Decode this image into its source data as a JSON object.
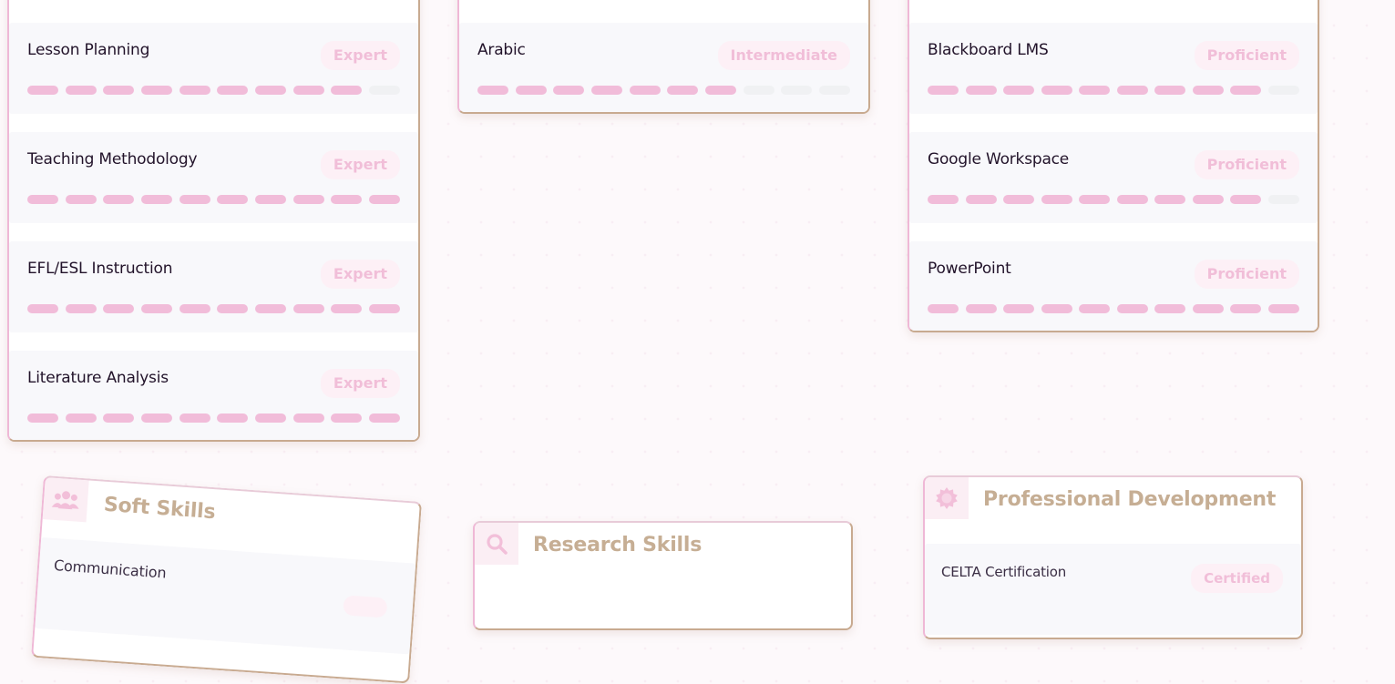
{
  "colors": {
    "accent_pink": "#f1bcd9",
    "heading_tan": "#c6ae94",
    "text_dark": "#22132a",
    "badge_bg": "#fdf0f6"
  },
  "teaching": {
    "skills": [
      {
        "name": "Lesson Planning",
        "level": "Expert",
        "filled": 9,
        "total": 10
      },
      {
        "name": "Teaching Methodology",
        "level": "Expert",
        "filled": 10,
        "total": 10
      },
      {
        "name": "EFL/ESL Instruction",
        "level": "Expert",
        "filled": 10,
        "total": 10
      },
      {
        "name": "Literature Analysis",
        "level": "Expert",
        "filled": 10,
        "total": 10
      }
    ]
  },
  "languages": {
    "skills": [
      {
        "name": "Arabic",
        "level": "Intermediate",
        "filled": 7,
        "total": 10
      }
    ]
  },
  "technology": {
    "skills": [
      {
        "name": "Blackboard LMS",
        "level": "Proficient",
        "filled": 9,
        "total": 10
      },
      {
        "name": "Google Workspace",
        "level": "Proficient",
        "filled": 9,
        "total": 10
      },
      {
        "name": "PowerPoint",
        "level": "Proficient",
        "filled": 10,
        "total": 10
      }
    ]
  },
  "soft_skills": {
    "title": "Soft Skills",
    "icon": "users-icon",
    "skills": [
      {
        "name": "Communication"
      }
    ]
  },
  "research_skills": {
    "title": "Research Skills",
    "icon": "search-icon"
  },
  "professional_development": {
    "title": "Professional Development",
    "icon": "badge-icon",
    "skills": [
      {
        "name": "CELTA Certification",
        "level": "Certified"
      }
    ]
  }
}
